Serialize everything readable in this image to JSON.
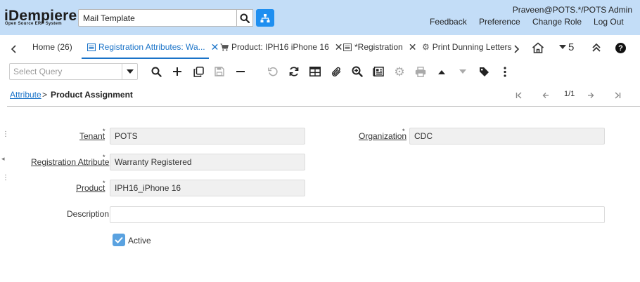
{
  "app": {
    "logo_text": "iDempiere",
    "logo_subtitle": "Open Source ERP System",
    "search_value": "Mail Template",
    "user": "Praveen@POTS.*/POTS Admin",
    "header_links": [
      "Feedback",
      "Preference",
      "Change Role",
      "Log Out"
    ]
  },
  "tabs": [
    {
      "label": "Home (26)",
      "icon": "none",
      "closable": false,
      "active": false
    },
    {
      "label": "Registration Attributes: Wa...",
      "icon": "window-icon",
      "closable": true,
      "active": true
    },
    {
      "label": "Product: IPH16 iPhone 16",
      "icon": "cart-icon",
      "closable": true,
      "active": false
    },
    {
      "label": "*Registration",
      "icon": "window-icon",
      "closable": true,
      "active": false
    },
    {
      "label": "Print Dunning Letters",
      "icon": "gear-icon",
      "closable": false,
      "active": false
    }
  ],
  "tabbar": {
    "count": "5"
  },
  "toolbar": {
    "query_placeholder": "Select Query",
    "buttons": [
      "search-icon",
      "new-record-icon",
      "copy-icon",
      "save-icon",
      "delete-icon",
      "undo-icon",
      "refresh-icon",
      "grid-toggle-icon",
      "attachment-icon",
      "zoom-across-icon",
      "report-icon",
      "process-icon",
      "print-icon",
      "previous-icon",
      "next-icon",
      "tag-icon",
      "more-icon"
    ]
  },
  "breadcrumb": {
    "parent": "Attribute",
    "separator": ">",
    "current": "Product Assignment",
    "record_count": "1/1"
  },
  "form": {
    "tenant": {
      "label": "Tenant",
      "value": "POTS"
    },
    "organization": {
      "label": "Organization",
      "value": "CDC"
    },
    "registration_attribute": {
      "label": "Registration Attribute",
      "value": "Warranty Registered"
    },
    "product": {
      "label": "Product",
      "value": "IPH16_iPhone 16"
    },
    "description": {
      "label": "Description",
      "value": ""
    },
    "active": {
      "label": "Active",
      "checked": true
    }
  },
  "colors": {
    "header_bg": "#c3ddf7",
    "accent": "#1a73c8",
    "sitemap_button": "#1f8ff0"
  }
}
